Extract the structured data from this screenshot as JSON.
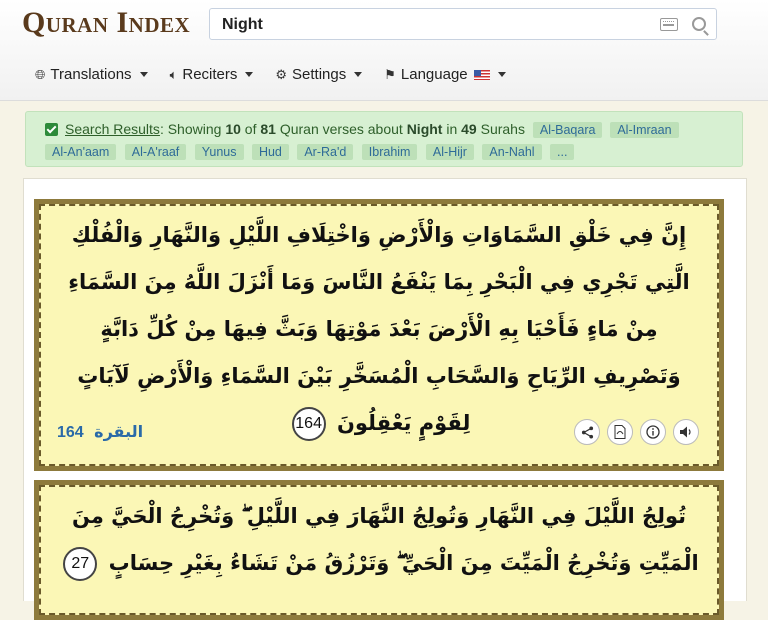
{
  "brand": {
    "logo": "Quran Index"
  },
  "search": {
    "value": "Night",
    "placeholder": ""
  },
  "nav": [
    {
      "label": "Translations",
      "icon": "globe-icon"
    },
    {
      "label": "Reciters",
      "icon": "speaker-icon"
    },
    {
      "label": "Settings",
      "icon": "gear-icon"
    },
    {
      "label": "Language",
      "icon": "flag-icon"
    }
  ],
  "results": {
    "link": "Search Results",
    "pre": ": Showing ",
    "count": "10",
    "of": " of ",
    "total": "81",
    "mid": " Quran verses about ",
    "term": "Night",
    "in": " in ",
    "surahs": "49",
    "post": " Surahs",
    "tags_row1": [
      "Al-Baqara",
      "Al-Imraan"
    ],
    "tags_row2": [
      "Al-An'aam",
      "Al-A'raaf",
      "Yunus",
      "Hud",
      "Ar-Ra'd",
      "Ibrahim",
      "Al-Hijr",
      "An-Nahl",
      "..."
    ]
  },
  "verses": [
    {
      "text": "إِنَّ فِي خَلْقِ السَّمَاوَاتِ وَالْأَرْضِ وَاخْتِلَافِ اللَّيْلِ وَالنَّهَارِ وَالْفُلْكِ الَّتِي تَجْرِي فِي الْبَحْرِ بِمَا يَنْفَعُ النَّاسَ وَمَا أَنْزَلَ اللَّهُ مِنَ السَّمَاءِ مِنْ مَاءٍ فَأَحْيَا بِهِ الْأَرْضَ بَعْدَ مَوْتِهَا وَبَثَّ فِيهَا مِنْ كُلِّ دَابَّةٍ وَتَصْرِيفِ الرِّيَاحِ وَالسَّحَابِ الْمُسَخَّرِ بَيْنَ السَّمَاءِ وَالْأَرْضِ لَآيَاتٍ لِقَوْمٍ يَعْقِلُونَ",
      "number": "164",
      "surah": "البقرة",
      "ref_number": "164"
    },
    {
      "text": "تُولِجُ اللَّيْلَ فِي النَّهَارِ وَتُولِجُ النَّهَارَ فِي اللَّيْلِ ۖ وَتُخْرِجُ الْحَيَّ مِنَ الْمَيِّتِ وَتُخْرِجُ الْمَيِّتَ مِنَ الْحَيِّ ۖ وَتَرْزُقُ مَنْ تَشَاءُ بِغَيْرِ حِسَابٍ",
      "number": "27"
    }
  ]
}
